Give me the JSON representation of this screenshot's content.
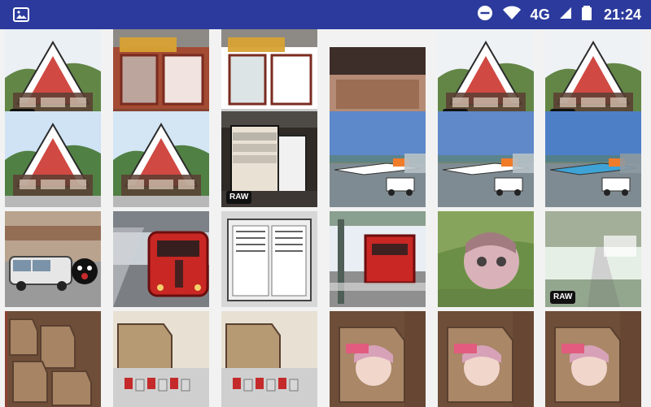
{
  "status_bar": {
    "network_label": "4G",
    "time": "21:24"
  },
  "badge": {
    "raw_label": "RAW"
  },
  "photos": [
    {
      "raw": true,
      "kind": "station-exterior",
      "colors": {
        "sky": "#eaf0f4",
        "wall": "#fff",
        "roof": "#cc3a33",
        "trees": "#5b7f3c"
      }
    },
    {
      "raw": false,
      "kind": "station-sign",
      "colors": {
        "sky": "#d7c7a6",
        "wall": "#a34b33",
        "sign": "#d7a233"
      }
    },
    {
      "raw": false,
      "kind": "station-sign-2",
      "colors": {
        "sky": "#efefef",
        "wall": "#fff",
        "sign": "#d7a233"
      }
    },
    {
      "raw": false,
      "kind": "sign-doai",
      "colors": {
        "sky": "#3e2e2a",
        "wall": "#f3f0ea",
        "sign": "#8b5a3c"
      }
    },
    {
      "raw": true,
      "kind": "station-exterior",
      "colors": {
        "sky": "#eef2f5",
        "wall": "#fff",
        "roof": "#cc3a33",
        "trees": "#5b7f3c"
      }
    },
    {
      "raw": true,
      "kind": "station-exterior",
      "colors": {
        "sky": "#eef2f5",
        "wall": "#fff",
        "roof": "#cc3a33",
        "trees": "#5b7f3c"
      }
    },
    {
      "raw": false,
      "kind": "station-exterior-2",
      "colors": {
        "sky": "#cfe3f4",
        "wall": "#fff",
        "roof": "#cc3a33",
        "trees": "#4a7a3a"
      }
    },
    {
      "raw": false,
      "kind": "station-exterior-2",
      "colors": {
        "sky": "#d4e6f4",
        "wall": "#fff",
        "roof": "#cc3a33",
        "trees": "#4a7a3a"
      }
    },
    {
      "raw": true,
      "kind": "interior-board",
      "colors": {
        "sky": "#2f2a25",
        "wall": "#3d3733",
        "sign": "#e9e2d4"
      }
    },
    {
      "raw": false,
      "kind": "airport",
      "colors": {
        "sky": "#5d88c9",
        "wall": "#b7c2c8",
        "sign": "#ffffff"
      }
    },
    {
      "raw": false,
      "kind": "airport",
      "colors": {
        "sky": "#5f89c8",
        "wall": "#b7c2c8",
        "sign": "#ffffff"
      }
    },
    {
      "raw": false,
      "kind": "airport-2",
      "colors": {
        "sky": "#4d7fc6",
        "wall": "#8d9aa3",
        "sign": "#3fa3d6"
      }
    },
    {
      "raw": false,
      "kind": "bus-mascot",
      "colors": {
        "sky": "#b9a38e",
        "wall": "#e6e6e6",
        "sign": "#111"
      }
    },
    {
      "raw": false,
      "kind": "train-red",
      "colors": {
        "sky": "#c9d1d6",
        "wall": "#7b7f84",
        "sign": "#c82724"
      }
    },
    {
      "raw": false,
      "kind": "timetable",
      "colors": {
        "sky": "#d7d7d7",
        "wall": "#efefef",
        "sign": "#222"
      }
    },
    {
      "raw": false,
      "kind": "train-platform",
      "colors": {
        "sky": "#e8eef3",
        "wall": "#7b8a80",
        "sign": "#c82724"
      }
    },
    {
      "raw": false,
      "kind": "anime-poster",
      "colors": {
        "sky": "#6b8f46",
        "wall": "#d8b2b8",
        "sign": "#a17b7f"
      }
    },
    {
      "raw": true,
      "kind": "temple-path",
      "colors": {
        "sky": "#e6efe6",
        "wall": "#d0d0d0",
        "sign": "#6e7a59"
      }
    },
    {
      "raw": false,
      "kind": "ema-wall",
      "colors": {
        "sky": "#6e4e38",
        "wall": "#a98767",
        "sign": "#c42a2a"
      }
    },
    {
      "raw": false,
      "kind": "ema-lock",
      "colors": {
        "sky": "#e8e1d3",
        "wall": "#b59a74",
        "sign": "#c42a2a"
      }
    },
    {
      "raw": false,
      "kind": "ema-lock",
      "colors": {
        "sky": "#e8e1d3",
        "wall": "#b59a74",
        "sign": "#c42a2a"
      }
    },
    {
      "raw": false,
      "kind": "ema-anime",
      "colors": {
        "sky": "#6e4e38",
        "wall": "#a98767",
        "sign": "#e15c7e"
      }
    },
    {
      "raw": false,
      "kind": "ema-anime",
      "colors": {
        "sky": "#6e4e38",
        "wall": "#a98767",
        "sign": "#e15c7e"
      }
    },
    {
      "raw": false,
      "kind": "ema-anime",
      "colors": {
        "sky": "#6e4e38",
        "wall": "#a98767",
        "sign": "#e15c7e"
      }
    }
  ]
}
